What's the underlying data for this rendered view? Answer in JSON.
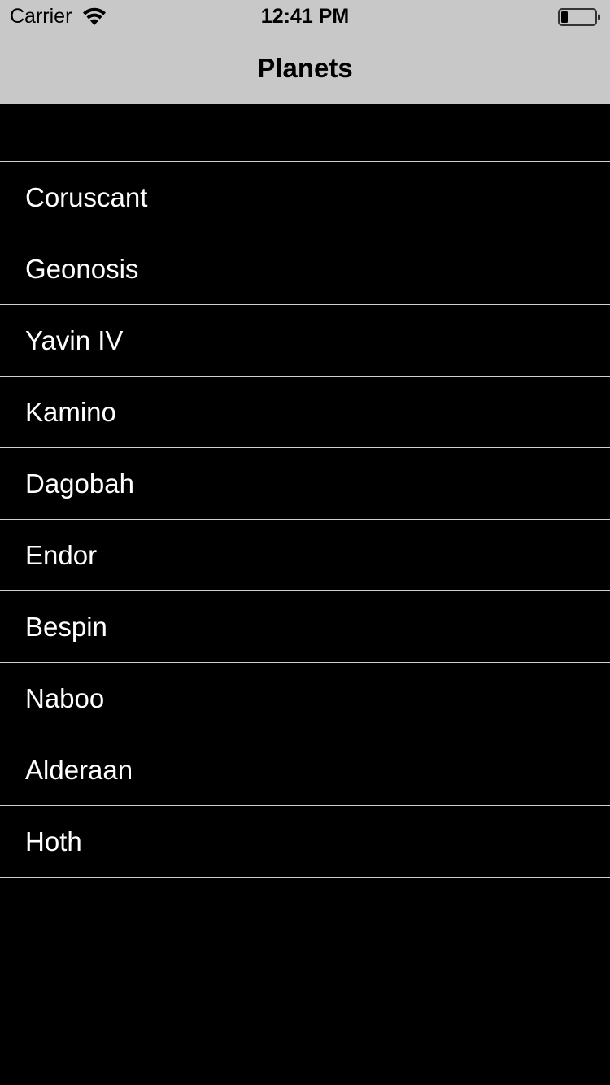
{
  "status_bar": {
    "carrier": "Carrier",
    "time": "12:41 PM",
    "wifi_icon": "wifi-icon",
    "battery_icon": "battery-icon"
  },
  "nav_bar": {
    "title": "Planets"
  },
  "planets": [
    {
      "label": "Coruscant"
    },
    {
      "label": "Geonosis"
    },
    {
      "label": "Yavin IV"
    },
    {
      "label": "Kamino"
    },
    {
      "label": "Dagobah"
    },
    {
      "label": "Endor"
    },
    {
      "label": "Bespin"
    },
    {
      "label": "Naboo"
    },
    {
      "label": "Alderaan"
    },
    {
      "label": "Hoth"
    }
  ],
  "colors": {
    "nav_background": "#c8c8c8",
    "list_background": "#000000",
    "row_text": "#ffffff",
    "separator": "#cfcfd4"
  }
}
